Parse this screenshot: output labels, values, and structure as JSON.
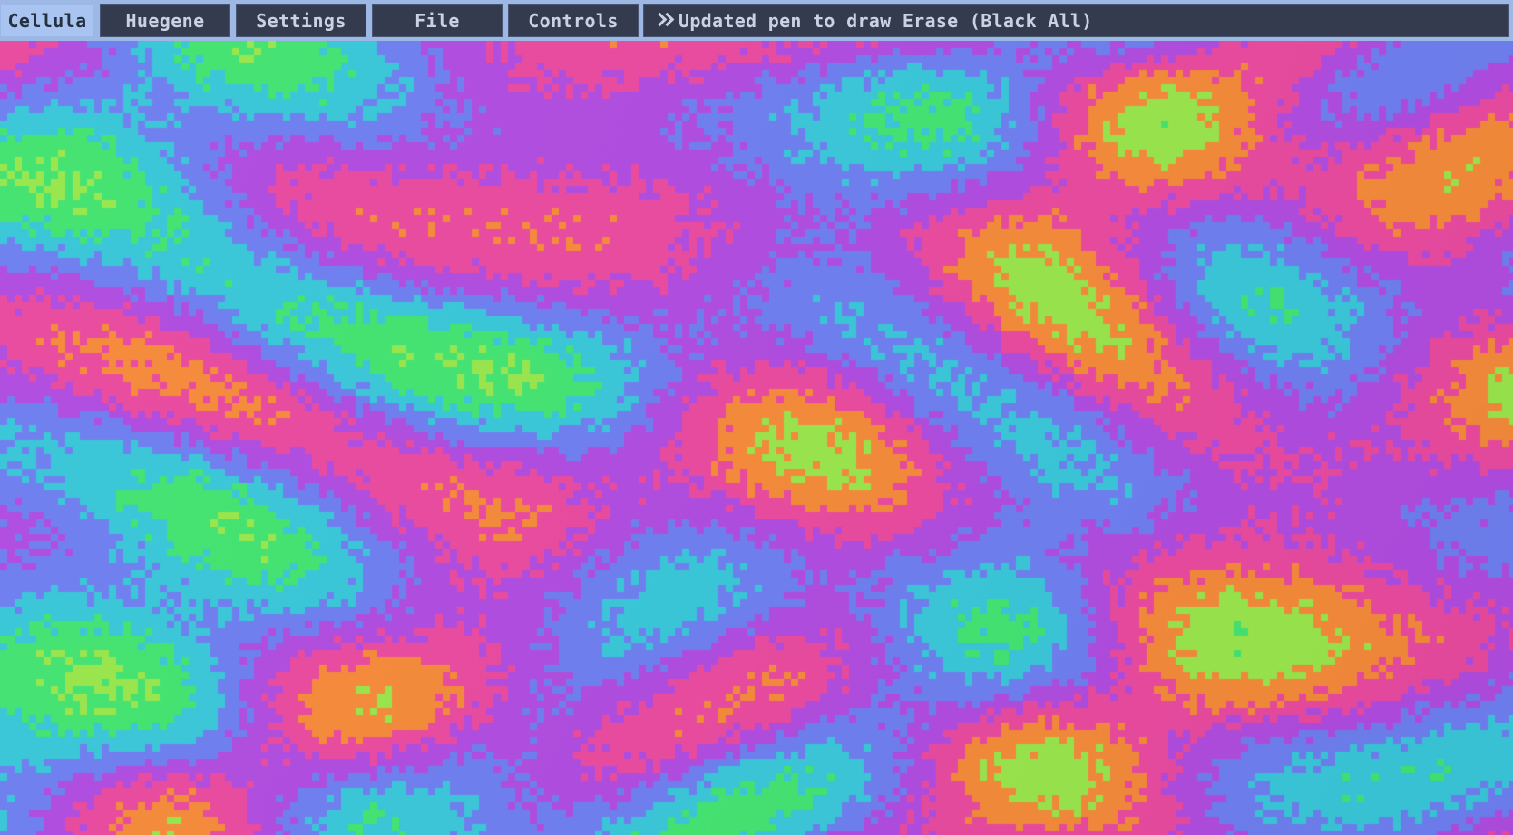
{
  "menu": {
    "app_label": "Cellula",
    "huegene_label": "Huegene",
    "settings_label": "Settings",
    "file_label": "File",
    "controls_label": "Controls"
  },
  "status": {
    "icon": "double-chevron-right-icon",
    "message": "Updated pen to draw Erase (Black All)"
  },
  "palette": {
    "magenta": "#b04ce0",
    "pink": "#e94a9f",
    "orange": "#f58a3a",
    "yellow_green": "#99e64c",
    "green": "#43e371",
    "cyan": "#39c7d9",
    "blue": "#6e7ff0"
  }
}
